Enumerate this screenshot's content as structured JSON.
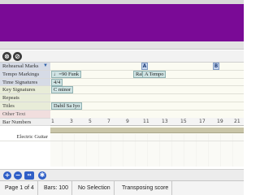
{
  "toolbar": {
    "close_glyph": "⊗",
    "options_glyph": "⊘"
  },
  "rows": [
    {
      "key": "rehearsal",
      "label": "Rehearsal Marks",
      "dropdown": "▼"
    },
    {
      "key": "tempo",
      "label": "Tempo Markings"
    },
    {
      "key": "time",
      "label": "Time Signatures"
    },
    {
      "key": "key",
      "label": "Key Signatures"
    },
    {
      "key": "repeats",
      "label": "Repeats"
    },
    {
      "key": "titles",
      "label": "Titles"
    },
    {
      "key": "other",
      "label": "Other Text"
    },
    {
      "key": "bars",
      "label": "Bar Numbers"
    }
  ],
  "timeline": {
    "rehearsal_marks": [
      "A",
      "B"
    ],
    "tempo": [
      "♩=90 Funk",
      "Ral",
      "A Tempo"
    ],
    "time_signature": "4/4",
    "key_signature": "C minor",
    "title": "Dabil Sa Iyo",
    "bar_numbers": [
      "1",
      "3",
      "5",
      "7",
      "9",
      "11",
      "13",
      "15",
      "17",
      "19",
      "21"
    ]
  },
  "track": {
    "name": "Electric Guitar"
  },
  "bottom_tools": {
    "add": "+",
    "remove": "−",
    "fit": "↔",
    "settings": "✱"
  },
  "status": {
    "page": "Page 1 of 4",
    "bars": "Bars: 100",
    "selection": "No Selection",
    "transpose": "Transposing score"
  },
  "colors": {
    "accent_panel": "#7a0a96",
    "marker": "#2f5fc7"
  }
}
